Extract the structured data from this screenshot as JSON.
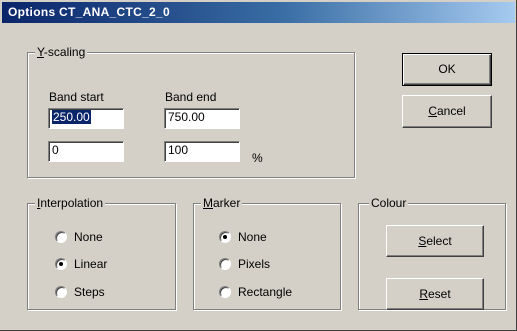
{
  "window": {
    "title": "Options CT_ANA_CTC_2_0"
  },
  "y_scaling": {
    "legend_u": "Y",
    "legend_rest": "-scaling",
    "band_start_label": "Band start",
    "band_end_label": "Band end",
    "band_start_value": "250.00",
    "band_end_value": "750.00",
    "min_value": "0",
    "max_value": "100",
    "unit": "%"
  },
  "buttons": {
    "ok": "OK",
    "cancel_u": "C",
    "cancel_rest": "ancel",
    "select_u": "S",
    "select_rest": "elect",
    "reset_u": "R",
    "reset_rest": "eset"
  },
  "interpolation": {
    "legend_u": "I",
    "legend_rest": "nterpolation",
    "options": [
      "None",
      "Linear",
      "Steps"
    ],
    "selected": "Linear"
  },
  "marker": {
    "legend_u": "M",
    "legend_rest": "arker",
    "options": [
      "None",
      "Pixels",
      "Rectangle"
    ],
    "selected": "None"
  },
  "colour": {
    "legend": "Colour"
  }
}
